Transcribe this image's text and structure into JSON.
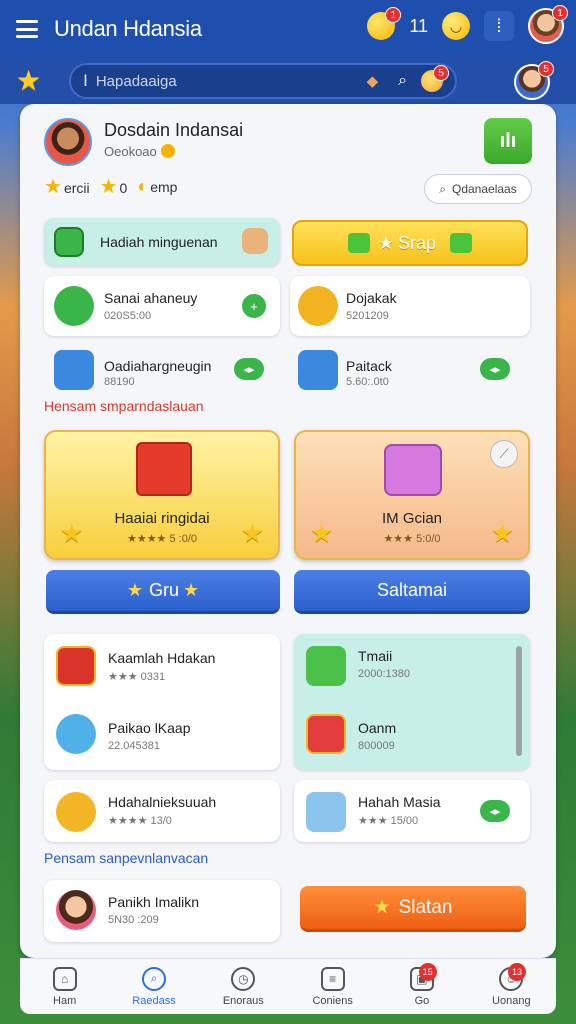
{
  "header": {
    "title": "Undan Hdansia",
    "coin_badge": "1",
    "count": "11",
    "avatar_badge": "1"
  },
  "search": {
    "placeholder": "Hapadaaiga",
    "badge": "5",
    "avatar_badge": "5"
  },
  "profile": {
    "name": "Dosdain Indansai",
    "sub": "Oeokoao",
    "stats": [
      "ercii",
      "0",
      "emp"
    ],
    "filter_label": "Qdanaelaas"
  },
  "row1": {
    "left_label": "Hadiah minguenan",
    "right_label": "Srap"
  },
  "list1": [
    {
      "title": "Sanai ahaneuy",
      "sub": "020S5:00"
    },
    {
      "title": "Dojakak",
      "sub": "5201209"
    },
    {
      "title": "Oadiahargneugin",
      "sub": "88190"
    },
    {
      "title": "Paitack",
      "sub": "5.60:.0t0"
    }
  ],
  "section1": "Hensam smparndaslauan",
  "cards": [
    {
      "title": "Haaiai ringidai",
      "sub": "5 :0/0"
    },
    {
      "title": "IM Gcian",
      "sub": "5:0/0"
    }
  ],
  "buttons": {
    "left": "Gru",
    "right": "Saltamai"
  },
  "list2": [
    {
      "title": "Kaamlah Hdakan",
      "sub": "0331"
    },
    {
      "title": "Tmaii",
      "sub": "2000:1380"
    },
    {
      "title": "Paikao lKaap",
      "sub": "22.045381"
    },
    {
      "title": "Oanm",
      "sub": "800009"
    },
    {
      "title": "Hdahalnieksuuah",
      "sub": "13/0"
    },
    {
      "title": "Hahah Masia",
      "sub": "15/00"
    }
  ],
  "section2": "Pensam sanpevnlanvacan",
  "bottom_card": {
    "title": "Panikh Imalikn",
    "sub": "5N30 :209"
  },
  "orange_btn": "Slatan",
  "nav": [
    {
      "label": "Ham",
      "icon": "home-icon"
    },
    {
      "label": "Raedass",
      "icon": "search-icon"
    },
    {
      "label": "Enoraus",
      "icon": "compass-icon"
    },
    {
      "label": "Coniens",
      "icon": "list-icon"
    },
    {
      "label": "Go",
      "icon": "gift-icon",
      "badge": "15"
    },
    {
      "label": "Uonang",
      "icon": "user-icon",
      "badge": "13"
    }
  ],
  "colors": {
    "header_blue": "#1f4fae",
    "accent_green": "#3ab54a",
    "accent_yellow": "#f6c21a",
    "accent_orange": "#ef5f13",
    "nav_active": "#2a6fe0"
  }
}
